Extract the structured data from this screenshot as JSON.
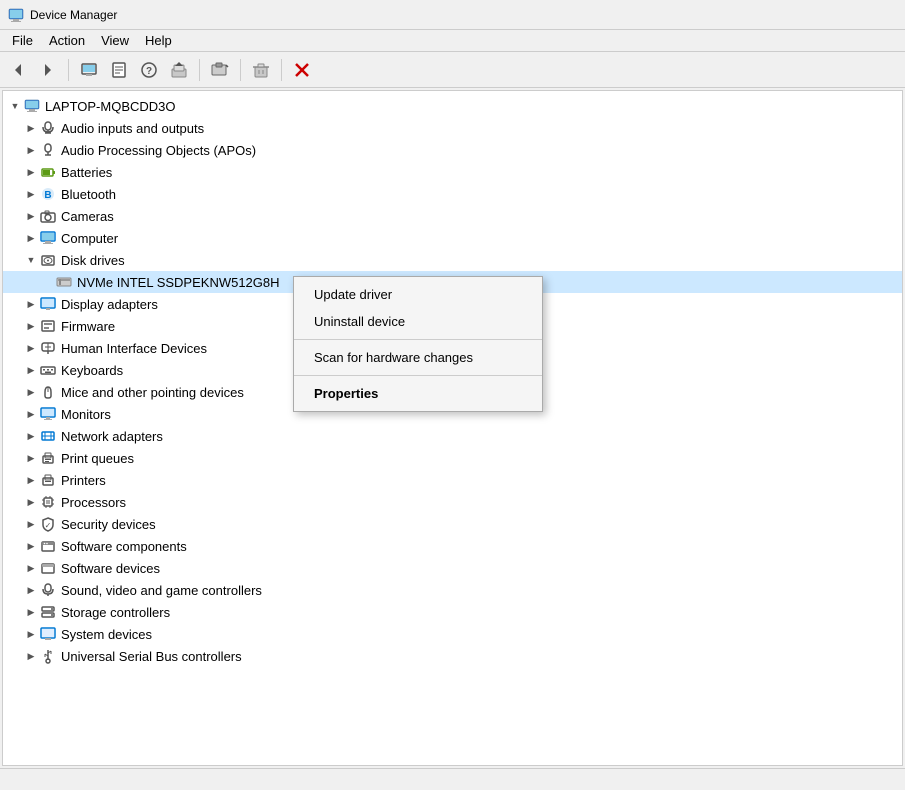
{
  "titleBar": {
    "icon": "🖥",
    "text": "Device Manager"
  },
  "menuBar": {
    "items": [
      "File",
      "Action",
      "View",
      "Help"
    ]
  },
  "toolbar": {
    "buttons": [
      {
        "name": "back",
        "icon": "◀",
        "label": "Back"
      },
      {
        "name": "forward",
        "icon": "▶",
        "label": "Forward"
      },
      {
        "name": "sep1",
        "type": "separator"
      },
      {
        "name": "show-hide",
        "icon": "🖥",
        "label": "Show/Hide"
      },
      {
        "name": "properties",
        "icon": "📄",
        "label": "Properties"
      },
      {
        "name": "help",
        "icon": "❓",
        "label": "Help"
      },
      {
        "name": "update-driver",
        "icon": "🔄",
        "label": "Update Driver"
      },
      {
        "name": "sep2",
        "type": "separator"
      },
      {
        "name": "uninstall",
        "icon": "🖥",
        "label": "Uninstall"
      },
      {
        "name": "sep3",
        "type": "separator"
      },
      {
        "name": "scan",
        "icon": "🔍",
        "label": "Scan"
      },
      {
        "name": "sep4",
        "type": "separator"
      },
      {
        "name": "remove",
        "icon": "✖",
        "label": "Remove",
        "color": "red"
      }
    ]
  },
  "tree": {
    "rootItem": {
      "name": "LAPTOP-MQBCDD3O",
      "expanded": true,
      "children": [
        {
          "label": "Audio inputs and outputs",
          "icon": "audio",
          "hasChildren": true
        },
        {
          "label": "Audio Processing Objects (APOs)",
          "icon": "audio",
          "hasChildren": true
        },
        {
          "label": "Batteries",
          "icon": "battery",
          "hasChildren": true
        },
        {
          "label": "Bluetooth",
          "icon": "bluetooth",
          "hasChildren": true
        },
        {
          "label": "Cameras",
          "icon": "camera",
          "hasChildren": true
        },
        {
          "label": "Computer",
          "icon": "computer",
          "hasChildren": true
        },
        {
          "label": "Disk drives",
          "icon": "disk",
          "hasChildren": true,
          "expanded": true,
          "children": [
            {
              "label": "NVMe INTEL SSDPEKNW512G8H",
              "icon": "nvme",
              "hasChildren": false,
              "selected": true
            }
          ]
        },
        {
          "label": "Display adapters",
          "icon": "display",
          "hasChildren": true
        },
        {
          "label": "Firmware",
          "icon": "firmware",
          "hasChildren": true
        },
        {
          "label": "Human Interface Devices",
          "icon": "hid",
          "hasChildren": true
        },
        {
          "label": "Keyboards",
          "icon": "keyboard",
          "hasChildren": true
        },
        {
          "label": "Mice and other pointing devices",
          "icon": "mice",
          "hasChildren": true
        },
        {
          "label": "Monitors",
          "icon": "monitor",
          "hasChildren": true
        },
        {
          "label": "Network adapters",
          "icon": "network",
          "hasChildren": true
        },
        {
          "label": "Print queues",
          "icon": "print",
          "hasChildren": true
        },
        {
          "label": "Printers",
          "icon": "print",
          "hasChildren": true
        },
        {
          "label": "Processors",
          "icon": "processor",
          "hasChildren": true
        },
        {
          "label": "Security devices",
          "icon": "security",
          "hasChildren": true
        },
        {
          "label": "Software components",
          "icon": "software",
          "hasChildren": true
        },
        {
          "label": "Software devices",
          "icon": "software",
          "hasChildren": true
        },
        {
          "label": "Sound, video and game controllers",
          "icon": "sound",
          "hasChildren": true
        },
        {
          "label": "Storage controllers",
          "icon": "storage",
          "hasChildren": true
        },
        {
          "label": "System devices",
          "icon": "system",
          "hasChildren": true
        },
        {
          "label": "Universal Serial Bus controllers",
          "icon": "usb",
          "hasChildren": true
        }
      ]
    }
  },
  "contextMenu": {
    "items": [
      {
        "label": "Update driver",
        "type": "normal"
      },
      {
        "label": "Uninstall device",
        "type": "normal"
      },
      {
        "type": "separator"
      },
      {
        "label": "Scan for hardware changes",
        "type": "normal"
      },
      {
        "type": "separator"
      },
      {
        "label": "Properties",
        "type": "bold"
      }
    ]
  },
  "statusBar": {
    "text": ""
  }
}
